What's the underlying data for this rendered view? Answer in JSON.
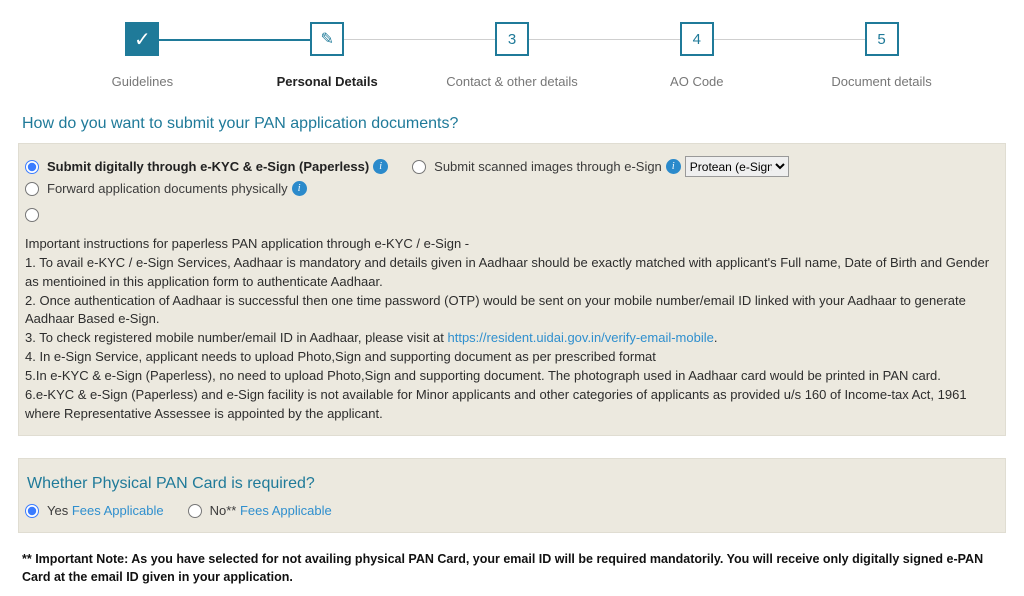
{
  "steps": [
    {
      "label": "Guidelines"
    },
    {
      "label": "Personal Details"
    },
    {
      "label": "Contact & other details",
      "num": "3"
    },
    {
      "label": "AO Code",
      "num": "4"
    },
    {
      "label": "Document details",
      "num": "5"
    }
  ],
  "q_submit": "How do you want to submit your PAN application documents?",
  "opt1": "Submit digitally through e-KYC & e-Sign (Paperless)",
  "opt2": "Submit scanned images through e-Sign",
  "opt3": "Forward application documents physically",
  "esign_select": "Protean (e-Sign)",
  "instr_title": "Important instructions for paperless PAN application through e-KYC / e-Sign -",
  "instr1": "1. To avail e-KYC / e-Sign Services, Aadhaar is mandatory and details given in Aadhaar should be exactly matched with applicant's Full name, Date of Birth and Gender as mentioined in this application form to authenticate Aadhaar.",
  "instr2": "2. Once authentication of Aadhaar is successful then one time password (OTP) would be sent on your mobile number/email ID linked with your Aadhaar to generate Aadhaar Based e-Sign.",
  "instr3a": "3. To check registered mobile number/email ID in Aadhaar, please visit at ",
  "instr3link": "https://resident.uidai.gov.in/verify-email-mobile",
  "instr3b": ".",
  "instr4": "4. In e-Sign Service, applicant needs to upload Photo,Sign and supporting document as per prescribed format",
  "instr5": "5.In e-KYC & e-Sign (Paperless), no need to upload Photo,Sign and supporting document. The photograph used in Aadhaar card would be printed in PAN card.",
  "instr6": "6.e-KYC & e-Sign (Paperless) and e-Sign facility is not available for Minor applicants and other categories of applicants as provided u/s 160 of Income-tax Act, 1961 where Representative Assessee is appointed by the applicant.",
  "q_physical": "Whether Physical PAN Card is required?",
  "yes_label": "Yes ",
  "no_label": "No** ",
  "fees_link": "Fees Applicable",
  "note": "** Important Note: As you have selected for not availing physical PAN Card, your email ID will be required mandatorily. You will receive only digitally signed e-PAN Card at the email ID given in your application."
}
